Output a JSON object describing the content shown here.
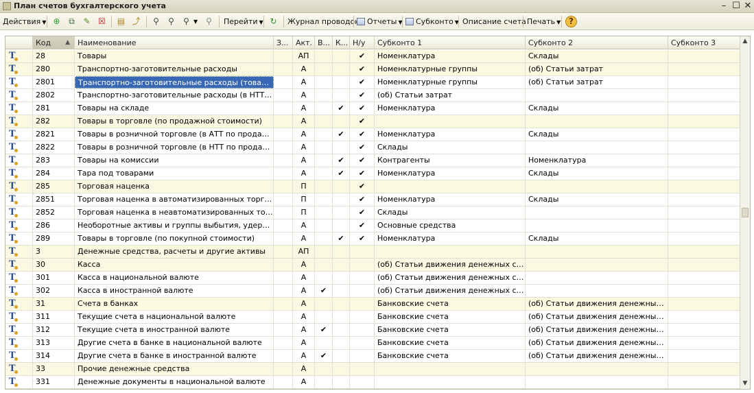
{
  "window": {
    "title": "План счетов бухгалтерского учета"
  },
  "toolbar": {
    "actions_label": "Действия",
    "goto_label": "Перейти",
    "journal_label": "Журнал проводок",
    "reports_label": "Отчеты",
    "subconto_label": "Субконто",
    "description_label": "Описание счета",
    "print_label": "Печать"
  },
  "columns": [
    "Код",
    "Наименование",
    "З...",
    "Акт.",
    "В...",
    "К...",
    "Н/у",
    "Субконто 1",
    "Субконто 2",
    "Субконто 3"
  ],
  "rows": [
    {
      "code": "28",
      "name": "Товары",
      "act": "АП",
      "v": "",
      "k": "",
      "nu": "✔",
      "s1": "Номенклатура",
      "s2": "Склады",
      "s3": "",
      "alt": true
    },
    {
      "code": "280",
      "name": "Транспортно-заготовительные расходы",
      "act": "А",
      "v": "",
      "k": "",
      "nu": "✔",
      "s1": "Номенклатурные группы",
      "s2": "(об) Статьи затрат",
      "s3": "",
      "alt": true
    },
    {
      "code": "2801",
      "name": "Транспортно-заготовительные расходы (товары)",
      "act": "А",
      "v": "",
      "k": "",
      "nu": "✔",
      "s1": "Номенклатурные группы",
      "s2": "(об) Статьи затрат",
      "s3": "",
      "alt": false,
      "selected": true
    },
    {
      "code": "2802",
      "name": "Транспортно-заготовительные расходы (в НТТ по пр...",
      "act": "А",
      "v": "",
      "k": "",
      "nu": "✔",
      "s1": "(об) Статьи затрат",
      "s2": "",
      "s3": "",
      "alt": false
    },
    {
      "code": "281",
      "name": "Товары на складе",
      "act": "А",
      "v": "",
      "k": "✔",
      "nu": "✔",
      "s1": "Номенклатура",
      "s2": "Склады",
      "s3": "",
      "alt": false
    },
    {
      "code": "282",
      "name": "Товары в торговле (по продажной стоимости)",
      "act": "А",
      "v": "",
      "k": "",
      "nu": "✔",
      "s1": "",
      "s2": "",
      "s3": "",
      "alt": true
    },
    {
      "code": "2821",
      "name": "Товары в розничной торговле (в АТТ по продажной с...",
      "act": "А",
      "v": "",
      "k": "✔",
      "nu": "✔",
      "s1": "Номенклатура",
      "s2": "Склады",
      "s3": "",
      "alt": false
    },
    {
      "code": "2822",
      "name": "Товары в розничной торговле (в НТТ по продажной с...",
      "act": "А",
      "v": "",
      "k": "",
      "nu": "✔",
      "s1": "Склады",
      "s2": "",
      "s3": "",
      "alt": false
    },
    {
      "code": "283",
      "name": "Товары на комиссии",
      "act": "А",
      "v": "",
      "k": "✔",
      "nu": "✔",
      "s1": "Контрагенты",
      "s2": "Номенклатура",
      "s3": "",
      "alt": false
    },
    {
      "code": "284",
      "name": "Тара под товарами",
      "act": "А",
      "v": "",
      "k": "✔",
      "nu": "✔",
      "s1": "Номенклатура",
      "s2": "Склады",
      "s3": "",
      "alt": false
    },
    {
      "code": "285",
      "name": "Торговая наценка",
      "act": "П",
      "v": "",
      "k": "",
      "nu": "✔",
      "s1": "",
      "s2": "",
      "s3": "",
      "alt": true
    },
    {
      "code": "2851",
      "name": "Торговая наценка в автоматизированных торговых т...",
      "act": "П",
      "v": "",
      "k": "",
      "nu": "✔",
      "s1": "Номенклатура",
      "s2": "Склады",
      "s3": "",
      "alt": false
    },
    {
      "code": "2852",
      "name": "Торговая наценка в неавтоматизированных торговы...",
      "act": "П",
      "v": "",
      "k": "",
      "nu": "✔",
      "s1": "Склады",
      "s2": "",
      "s3": "",
      "alt": false
    },
    {
      "code": "286",
      "name": "Необоротные активы и группы выбытия, удерживае...",
      "act": "А",
      "v": "",
      "k": "",
      "nu": "✔",
      "s1": "Основные средства",
      "s2": "",
      "s3": "",
      "alt": false
    },
    {
      "code": "289",
      "name": "Товары в торговле (по покупной стоимости)",
      "act": "А",
      "v": "",
      "k": "✔",
      "nu": "✔",
      "s1": "Номенклатура",
      "s2": "Склады",
      "s3": "",
      "alt": false
    },
    {
      "code": "3",
      "name": "Денежные средства, расчеты и другие активы",
      "act": "АП",
      "v": "",
      "k": "",
      "nu": "",
      "s1": "",
      "s2": "",
      "s3": "",
      "alt": true
    },
    {
      "code": "30",
      "name": "Касса",
      "act": "А",
      "v": "",
      "k": "",
      "nu": "",
      "s1": "(об) Статьи движения денежных средств",
      "s2": "",
      "s3": "",
      "alt": true
    },
    {
      "code": "301",
      "name": "Касса в национальной валюте",
      "act": "А",
      "v": "",
      "k": "",
      "nu": "",
      "s1": "(об) Статьи движения денежных средств",
      "s2": "",
      "s3": "",
      "alt": false
    },
    {
      "code": "302",
      "name": "Касса в иностранной валюте",
      "act": "А",
      "v": "✔",
      "k": "",
      "nu": "",
      "s1": "(об) Статьи движения денежных средств",
      "s2": "",
      "s3": "",
      "alt": false
    },
    {
      "code": "31",
      "name": "Счета в банках",
      "act": "А",
      "v": "",
      "k": "",
      "nu": "",
      "s1": "Банковские счета",
      "s2": "(об) Статьи движения денежных сред...",
      "s3": "",
      "alt": true
    },
    {
      "code": "311",
      "name": "Текущие счета в национальной валюте",
      "act": "А",
      "v": "",
      "k": "",
      "nu": "",
      "s1": "Банковские счета",
      "s2": "(об) Статьи движения денежных сред...",
      "s3": "",
      "alt": false
    },
    {
      "code": "312",
      "name": "Текущие счета в иностранной валюте",
      "act": "А",
      "v": "✔",
      "k": "",
      "nu": "",
      "s1": "Банковские счета",
      "s2": "(об) Статьи движения денежных сред...",
      "s3": "",
      "alt": false
    },
    {
      "code": "313",
      "name": "Другие счета в банке в национальной валюте",
      "act": "А",
      "v": "",
      "k": "",
      "nu": "",
      "s1": "Банковские счета",
      "s2": "(об) Статьи движения денежных сред...",
      "s3": "",
      "alt": false
    },
    {
      "code": "314",
      "name": "Другие счета в банке в иностранной валюте",
      "act": "А",
      "v": "✔",
      "k": "",
      "nu": "",
      "s1": "Банковские счета",
      "s2": "(об) Статьи движения денежных сред...",
      "s3": "",
      "alt": false
    },
    {
      "code": "33",
      "name": "Прочие денежные средства",
      "act": "А",
      "v": "",
      "k": "",
      "nu": "",
      "s1": "",
      "s2": "",
      "s3": "",
      "alt": true
    },
    {
      "code": "331",
      "name": "Денежные документы в национальной валюте",
      "act": "А",
      "v": "",
      "k": "",
      "nu": "",
      "s1": "",
      "s2": "",
      "s3": "",
      "alt": false
    }
  ]
}
